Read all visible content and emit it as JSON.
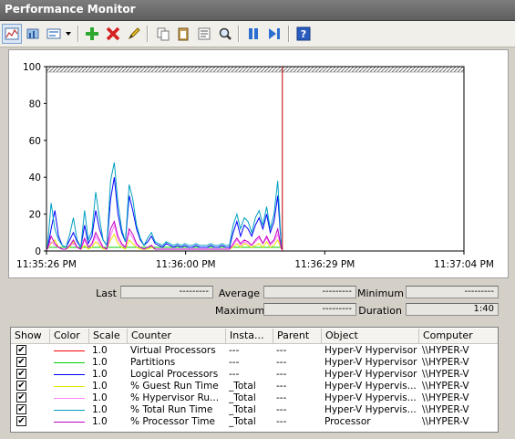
{
  "window": {
    "title": "Performance Monitor"
  },
  "toolbar": {
    "buttons": [
      {
        "name": "view-graph-icon"
      },
      {
        "name": "view-histogram-icon"
      },
      {
        "name": "change-graph-type-icon"
      },
      {
        "name": "add-counter-icon"
      },
      {
        "name": "delete-counter-icon"
      },
      {
        "name": "highlight-icon"
      },
      {
        "name": "copy-properties-icon"
      },
      {
        "name": "paste-counter-list-icon"
      },
      {
        "name": "properties-icon"
      },
      {
        "name": "zoom-icon"
      },
      {
        "name": "freeze-display-icon"
      },
      {
        "name": "update-data-icon"
      },
      {
        "name": "help-icon"
      }
    ]
  },
  "chart_data": {
    "type": "line",
    "ylim": [
      0,
      100
    ],
    "y_ticks": [
      "100",
      "80",
      "60",
      "40",
      "20",
      "0"
    ],
    "x_ticks": [
      "11:35:26 PM",
      "11:36:00 PM",
      "11:36:29 PM",
      "11:37:04 PM"
    ],
    "grid": true,
    "current_position_fraction": 0.565,
    "series": [
      {
        "name": "Virtual Processors",
        "color": "#ff0000",
        "values": [
          2,
          2,
          2,
          2,
          2,
          2,
          2,
          2,
          2,
          2,
          2,
          2,
          2,
          2,
          2,
          2,
          2,
          2,
          2,
          2,
          2,
          2,
          2,
          2,
          2,
          2,
          2,
          2,
          2,
          2,
          2,
          2,
          2,
          2,
          2,
          2,
          2,
          2,
          2,
          2,
          2,
          2,
          2,
          2,
          2,
          2,
          2,
          2,
          2,
          2,
          2,
          2,
          2,
          2,
          2,
          2,
          2,
          2,
          2,
          2,
          2,
          2,
          2,
          2
        ]
      },
      {
        "name": "Partitions",
        "color": "#00d000",
        "values": [
          2,
          2,
          2,
          2,
          2,
          2,
          2,
          2,
          2,
          2,
          2,
          2,
          2,
          2,
          2,
          2,
          2,
          2,
          2,
          2,
          2,
          2,
          2,
          2,
          2,
          2,
          2,
          2,
          2,
          2,
          2,
          2,
          2,
          2,
          2,
          2,
          2,
          2,
          2,
          2,
          2,
          2,
          2,
          2,
          2,
          2,
          2,
          2,
          2,
          2,
          2,
          2,
          2,
          2,
          2,
          2,
          2,
          2,
          2,
          2,
          2,
          2,
          2,
          2
        ]
      },
      {
        "name": "Logical Processors",
        "color": "#0000ff",
        "values": [
          1,
          12,
          22,
          8,
          3,
          2,
          6,
          10,
          5,
          2,
          14,
          4,
          8,
          22,
          12,
          6,
          3,
          28,
          40,
          20,
          10,
          5,
          30,
          22,
          12,
          6,
          3,
          5,
          8,
          4,
          3,
          2,
          4,
          3,
          2,
          3,
          2,
          3,
          2,
          2,
          3,
          2,
          2,
          2,
          3,
          2,
          2,
          3,
          2,
          2,
          10,
          16,
          8,
          14,
          12,
          8,
          14,
          18,
          12,
          20,
          10,
          16,
          30,
          1
        ]
      },
      {
        "name": "% Guest Run Time",
        "color": "#e8e800",
        "values": [
          1,
          4,
          6,
          2,
          1,
          1,
          2,
          5,
          2,
          1,
          3,
          1,
          2,
          5,
          3,
          1,
          1,
          6,
          9,
          4,
          2,
          1,
          6,
          4,
          2,
          1,
          1,
          1,
          2,
          1,
          1,
          1,
          1,
          1,
          1,
          1,
          1,
          1,
          1,
          1,
          1,
          1,
          1,
          1,
          1,
          1,
          1,
          1,
          1,
          1,
          2,
          4,
          2,
          4,
          3,
          2,
          3,
          4,
          2,
          5,
          2,
          3,
          6,
          1
        ]
      },
      {
        "name": "% Hypervisor Run Time",
        "color": "#ff80ff",
        "values": [
          1,
          5,
          3,
          2,
          1,
          1,
          3,
          4,
          2,
          1,
          6,
          2,
          3,
          8,
          4,
          2,
          1,
          8,
          14,
          6,
          3,
          2,
          10,
          7,
          3,
          2,
          1,
          2,
          3,
          1,
          1,
          1,
          1,
          1,
          1,
          1,
          1,
          1,
          1,
          1,
          1,
          1,
          1,
          1,
          1,
          1,
          1,
          1,
          1,
          1,
          3,
          6,
          3,
          5,
          4,
          3,
          5,
          7,
          4,
          7,
          3,
          5,
          9,
          1
        ]
      },
      {
        "name": "% Total Run Time",
        "color": "#00a0c0",
        "values": [
          2,
          26,
          12,
          6,
          3,
          2,
          9,
          18,
          6,
          2,
          22,
          6,
          11,
          32,
          18,
          6,
          3,
          38,
          48,
          26,
          12,
          5,
          36,
          28,
          14,
          7,
          3,
          7,
          10,
          5,
          4,
          3,
          5,
          4,
          3,
          4,
          3,
          4,
          3,
          3,
          4,
          3,
          3,
          3,
          4,
          3,
          3,
          4,
          3,
          3,
          14,
          20,
          12,
          18,
          16,
          10,
          18,
          22,
          14,
          24,
          12,
          20,
          38,
          1
        ]
      },
      {
        "name": "% Processor Time",
        "color": "#c000c0",
        "values": [
          1,
          8,
          4,
          2,
          1,
          1,
          3,
          6,
          2,
          1,
          7,
          2,
          4,
          10,
          6,
          2,
          1,
          12,
          16,
          8,
          4,
          2,
          12,
          9,
          4,
          2,
          1,
          2,
          3,
          1,
          1,
          1,
          1,
          1,
          1,
          1,
          1,
          1,
          1,
          1,
          1,
          1,
          1,
          1,
          1,
          1,
          1,
          1,
          1,
          1,
          4,
          7,
          4,
          6,
          5,
          3,
          6,
          8,
          4,
          8,
          4,
          6,
          12,
          1
        ]
      }
    ]
  },
  "stats": {
    "last_label": "Last",
    "last_value": "---------",
    "average_label": "Average",
    "average_value": "---------",
    "minimum_label": "Minimum",
    "minimum_value": "---------",
    "maximum_label": "Maximum",
    "maximum_value": "---------",
    "duration_label": "Duration",
    "duration_value": "1:40"
  },
  "counter_list": {
    "headers": [
      "Show",
      "Color",
      "Scale",
      "Counter",
      "Insta...",
      "Parent",
      "Object",
      "Computer"
    ],
    "rows": [
      {
        "color": "#ff0000",
        "scale": "1.0",
        "counter": "Virtual Processors",
        "instance": "---",
        "parent": "---",
        "object": "Hyper-V Hypervisor",
        "computer": "\\\\HYPER-V"
      },
      {
        "color": "#00d000",
        "scale": "1.0",
        "counter": "Partitions",
        "instance": "---",
        "parent": "---",
        "object": "Hyper-V Hypervisor",
        "computer": "\\\\HYPER-V"
      },
      {
        "color": "#0000ff",
        "scale": "1.0",
        "counter": "Logical Processors",
        "instance": "---",
        "parent": "---",
        "object": "Hyper-V Hypervisor",
        "computer": "\\\\HYPER-V"
      },
      {
        "color": "#e8e800",
        "scale": "1.0",
        "counter": "% Guest Run Time",
        "instance": "_Total",
        "parent": "---",
        "object": "Hyper-V Hypervis...",
        "computer": "\\\\HYPER-V"
      },
      {
        "color": "#ff80ff",
        "scale": "1.0",
        "counter": "% Hypervisor Ru...",
        "instance": "_Total",
        "parent": "---",
        "object": "Hyper-V Hypervis...",
        "computer": "\\\\HYPER-V"
      },
      {
        "color": "#00a0c0",
        "scale": "1.0",
        "counter": "% Total Run Time",
        "instance": "_Total",
        "parent": "---",
        "object": "Hyper-V Hypervis...",
        "computer": "\\\\HYPER-V"
      },
      {
        "color": "#c000c0",
        "scale": "1.0",
        "counter": "% Processor Time",
        "instance": "_Total",
        "parent": "---",
        "object": "Processor",
        "computer": "\\\\HYPER-V"
      }
    ]
  }
}
